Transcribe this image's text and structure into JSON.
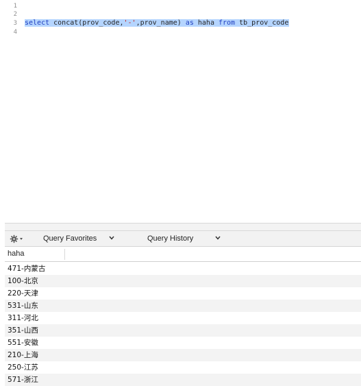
{
  "editor": {
    "line_numbers": [
      "1",
      "2",
      "3",
      "4"
    ],
    "query": {
      "kw_select": "select",
      "part1": " concat(prov_code,",
      "string": "'-'",
      "part2": ",prov_name) ",
      "kw_as": "as",
      "part3": " haha ",
      "kw_from": "from",
      "part4": " tb_prov_code"
    }
  },
  "toolbar": {
    "gear_icon": "gear-icon",
    "favorites_label": "Query Favorites",
    "history_label": "Query History"
  },
  "results": {
    "column_header": "haha",
    "rows": [
      "471-内蒙古",
      "100-北京",
      "220-天津",
      "531-山东",
      "311-河北",
      "351-山西",
      "551-安徽",
      "210-上海",
      "250-江苏",
      "571-浙江"
    ]
  },
  "colors": {
    "selection": "#b5d5ff",
    "keyword": "#1d3dbf",
    "string": "#c41a16",
    "alt_row": "#f3f3f3"
  }
}
